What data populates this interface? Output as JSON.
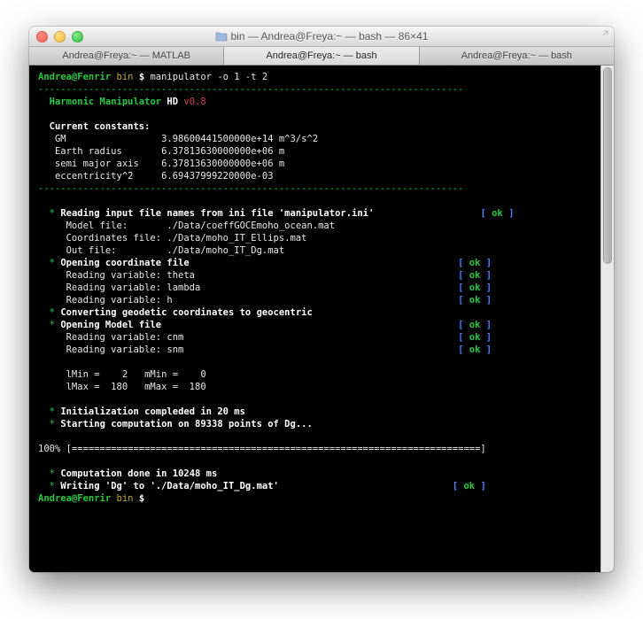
{
  "window": {
    "title": "bin — Andrea@Freya:~ — bash — 86×41"
  },
  "tabs": [
    {
      "label": "Andrea@Freya:~ — MATLAB"
    },
    {
      "label": "Andrea@Freya:~ — bash"
    },
    {
      "label": "Andrea@Freya:~ — bash"
    }
  ],
  "prompt": {
    "user_host": "Andrea@Fenrir",
    "cwd": "bin",
    "symbol": "$",
    "command": "manipulator -o 1 -t 2"
  },
  "banner": {
    "name": "Harmonic Manipulator",
    "edition": "HD",
    "version": "v0.8"
  },
  "constants": {
    "heading": "Current constants:",
    "rows": [
      {
        "label": "GM",
        "value": "3.98600441500000e+14 m^3/s^2"
      },
      {
        "label": "Earth radius",
        "value": "6.37813630000000e+06 m"
      },
      {
        "label": "semi major axis",
        "value": "6.37813630000000e+06 m"
      },
      {
        "label": "eccentricity^2",
        "value": "6.69437999220000e-03"
      }
    ]
  },
  "log": {
    "step1": {
      "title": "Reading input file names from ini file 'manipulator.ini'",
      "model_label": "Model file:",
      "model_value": "./Data/coeffGOCEmoho_ocean.mat",
      "coords_label": "Coordinates file:",
      "coords_value": "./Data/moho_IT_Ellips.mat",
      "out_label": "Out file:",
      "out_value": "./Data/moho_IT_Dg.mat"
    },
    "step2": {
      "title": "Opening coordinate file",
      "l1": "Reading variable: theta",
      "l2": "Reading variable: lambda",
      "l3": "Reading variable: h"
    },
    "step3": "Converting geodetic coordinates to geocentric",
    "step4": {
      "title": "Opening Model file",
      "l1": "Reading variable: cnm",
      "l2": "Reading variable: snm"
    },
    "ranges": {
      "l1": "lMin =    2   mMin =    0",
      "l2": "lMax =  180   mMax =  180"
    },
    "init": "Initialization compleded in 20 ms",
    "start": "Starting computation on 89338 points of Dg...",
    "progress_label": "100%",
    "progress_bar": "[=========================================================================]",
    "done": "Computation done in 10248 ms",
    "write": "Writing 'Dg' to './Data/moho_IT_Dg.mat'"
  },
  "status": {
    "ok_open": "[",
    "ok_word": " ok ",
    "ok_close": "]"
  },
  "divider": "----------------------------------------------------------------------------"
}
